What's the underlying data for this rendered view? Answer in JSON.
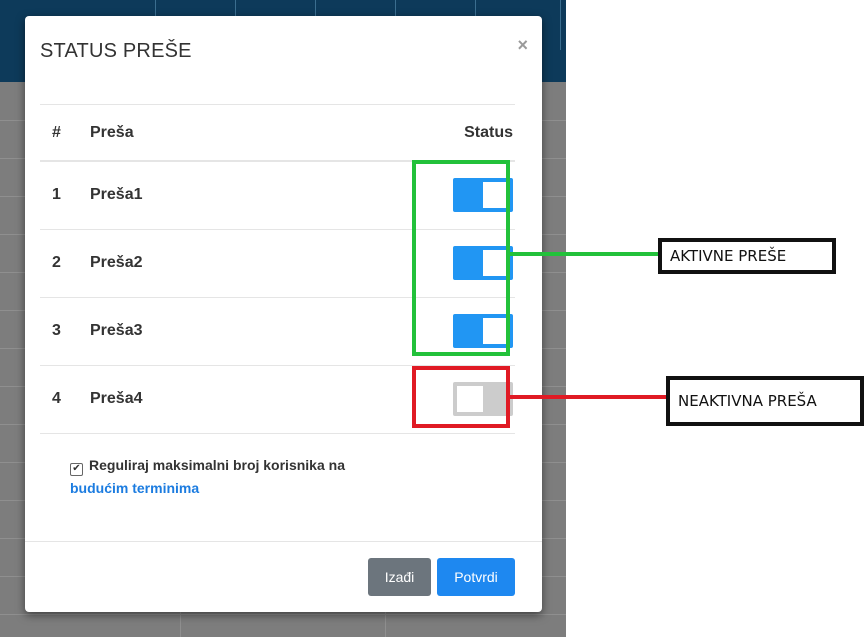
{
  "modal": {
    "title": "STATUS PREŠE",
    "close_glyph": "×",
    "columns": {
      "num": "#",
      "name": "Preša",
      "status": "Status"
    },
    "rows": [
      {
        "num": "1",
        "name": "Preša1",
        "active": true
      },
      {
        "num": "2",
        "name": "Preša2",
        "active": true
      },
      {
        "num": "3",
        "name": "Preša3",
        "active": true
      },
      {
        "num": "4",
        "name": "Preša4",
        "active": false
      }
    ],
    "checkbox": {
      "checked": true,
      "label_part1": "Reguliraj maksimalni broj korisnika na",
      "label_part2": "budućim terminima"
    },
    "buttons": {
      "exit": "Izađi",
      "confirm": "Potvrdi"
    }
  },
  "annotations": {
    "active_label": "AKTIVNE PREŠE",
    "inactive_label": "NEAKTIVNA PREŠA"
  },
  "colors": {
    "toggle_on": "#2196f3",
    "toggle_off": "#cccccc",
    "annotation_active": "#22c13a",
    "annotation_inactive": "#e01a24",
    "confirm_button": "#1e88f0",
    "exit_button": "#6c757d"
  }
}
